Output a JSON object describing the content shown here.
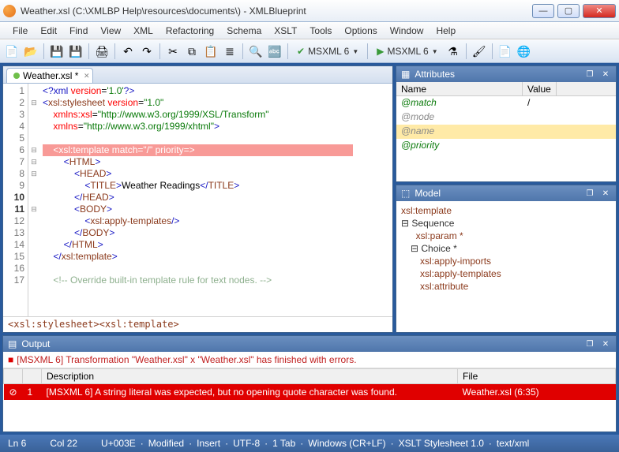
{
  "title": "Weather.xsl  (C:\\XMLBP Help\\resources\\documents\\) - XMLBlueprint",
  "menu": [
    "File",
    "Edit",
    "Find",
    "View",
    "XML",
    "Refactoring",
    "Schema",
    "XSLT",
    "Tools",
    "Options",
    "Window",
    "Help"
  ],
  "msxml_validate": "MSXML 6",
  "msxml_run": "MSXML 6",
  "tab": {
    "label": "Weather.xsl *"
  },
  "lines": [
    {
      "n": "1",
      "fold": "",
      "i": 0,
      "segs": [
        [
          "blue",
          "<?xml"
        ],
        [
          "red",
          " version"
        ],
        [
          "black",
          "="
        ],
        [
          "green",
          "'1.0'"
        ],
        [
          "blue",
          "?>"
        ]
      ]
    },
    {
      "n": "2",
      "fold": "⊟",
      "i": 0,
      "segs": [
        [
          "blue",
          "<"
        ],
        [
          "brown",
          "xsl:stylesheet"
        ],
        [
          "red",
          " version"
        ],
        [
          "black",
          "="
        ],
        [
          "green",
          "\"1.0\""
        ]
      ]
    },
    {
      "n": "3",
      "fold": "",
      "i": 1,
      "segs": [
        [
          "red",
          "xmlns:xsl"
        ],
        [
          "black",
          "="
        ],
        [
          "green",
          "\"http://www.w3.org/1999/XSL/Transform\""
        ]
      ]
    },
    {
      "n": "4",
      "fold": "",
      "i": 1,
      "segs": [
        [
          "red",
          "xmlns"
        ],
        [
          "black",
          "="
        ],
        [
          "green",
          "\"http://www.w3.org/1999/xhtml\""
        ],
        [
          "blue",
          ">"
        ]
      ]
    },
    {
      "n": "5",
      "fold": "",
      "i": 0,
      "segs": []
    },
    {
      "n": "6",
      "fold": "⊟",
      "i": 1,
      "hl": true,
      "text": "<xsl:template match=\"/\" priority=>"
    },
    {
      "n": "7",
      "fold": "⊟",
      "i": 2,
      "segs": [
        [
          "blue",
          "<"
        ],
        [
          "brown",
          "HTML"
        ],
        [
          "blue",
          ">"
        ]
      ]
    },
    {
      "n": "8",
      "fold": "⊟",
      "i": 3,
      "segs": [
        [
          "blue",
          "<"
        ],
        [
          "brown",
          "HEAD"
        ],
        [
          "blue",
          ">"
        ]
      ]
    },
    {
      "n": "9",
      "fold": "",
      "i": 4,
      "segs": [
        [
          "blue",
          "<"
        ],
        [
          "brown",
          "TITLE"
        ],
        [
          "blue",
          ">"
        ],
        [
          "black",
          "Weather Readings"
        ],
        [
          "blue",
          "</"
        ],
        [
          "brown",
          "TITLE"
        ],
        [
          "blue",
          ">"
        ]
      ]
    },
    {
      "n": "10",
      "fold": "",
      "i": 3,
      "b": true,
      "segs": [
        [
          "blue",
          "</"
        ],
        [
          "brown",
          "HEAD"
        ],
        [
          "blue",
          ">"
        ]
      ]
    },
    {
      "n": "11",
      "fold": "⊟",
      "i": 3,
      "b": true,
      "segs": [
        [
          "blue",
          "<"
        ],
        [
          "brown",
          "BODY"
        ],
        [
          "blue",
          ">"
        ]
      ]
    },
    {
      "n": "12",
      "fold": "",
      "i": 4,
      "segs": [
        [
          "blue",
          "<"
        ],
        [
          "brown",
          "xsl:apply-templates"
        ],
        [
          "blue",
          "/>"
        ]
      ]
    },
    {
      "n": "13",
      "fold": "",
      "i": 3,
      "segs": [
        [
          "blue",
          "</"
        ],
        [
          "brown",
          "BODY"
        ],
        [
          "blue",
          ">"
        ]
      ]
    },
    {
      "n": "14",
      "fold": "",
      "i": 2,
      "segs": [
        [
          "blue",
          "</"
        ],
        [
          "brown",
          "HTML"
        ],
        [
          "blue",
          ">"
        ]
      ]
    },
    {
      "n": "15",
      "fold": "",
      "i": 1,
      "segs": [
        [
          "blue",
          "</"
        ],
        [
          "brown",
          "xsl:template"
        ],
        [
          "blue",
          ">"
        ]
      ]
    },
    {
      "n": "16",
      "fold": "",
      "i": 0,
      "segs": []
    },
    {
      "n": "17",
      "fold": "",
      "i": 1,
      "segs": [
        [
          "lgreen",
          "<!-- Override built-in template rule for text nodes. -->"
        ]
      ]
    }
  ],
  "breadcrumb": "<xsl:stylesheet><xsl:template>",
  "attributes": {
    "title": "Attributes",
    "headers": [
      "Name",
      "Value"
    ],
    "rows": [
      {
        "name": "@match",
        "value": "/",
        "c": "#0a7a0a"
      },
      {
        "name": "@mode",
        "value": "",
        "c": "#888"
      },
      {
        "name": "@name",
        "value": "",
        "c": "#888",
        "sel": true
      },
      {
        "name": "@priority",
        "value": "",
        "c": "#0a7a0a"
      }
    ]
  },
  "model": {
    "title": "Model",
    "root": "xsl:template",
    "seq": "Sequence",
    "param": "xsl:param *",
    "choice": "Choice *",
    "items": [
      "xsl:apply-imports",
      "xsl:apply-templates",
      "xsl:attribute"
    ]
  },
  "output": {
    "title": "Output",
    "summary": "[MSXML 6] Transformation \"Weather.xsl\" x \"Weather.xsl\" has finished with errors.",
    "headers": [
      "",
      "",
      "Description",
      "File"
    ],
    "row": {
      "n": "1",
      "desc": "[MSXML 6] A string literal was expected, but no opening quote character was found.",
      "file": "Weather.xsl (6:35)"
    }
  },
  "status": [
    "Ln 6",
    "Col 22",
    "U+003E",
    "Modified",
    "Insert",
    "UTF-8",
    "1 Tab",
    "Windows (CR+LF)",
    "XSLT Stylesheet 1.0",
    "text/xml"
  ]
}
